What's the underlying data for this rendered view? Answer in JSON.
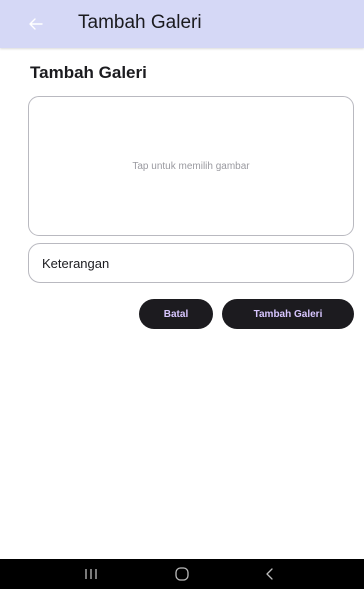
{
  "appbar": {
    "title": "Tambah Galeri",
    "back_icon": "arrow-left-icon",
    "background": "#d5d8f6"
  },
  "main": {
    "title": "Tambah Galeri",
    "image_picker": {
      "hint": "Tap untuk memilih gambar"
    },
    "caption_field": {
      "placeholder": "Keterangan",
      "value": ""
    },
    "buttons": {
      "cancel_label": "Batal",
      "submit_label": "Tambah Galeri",
      "background": "#1c1b1f",
      "text_color": "#d8c6ff"
    }
  },
  "system_nav": {
    "recents_icon": "recents-icon",
    "home_icon": "home-icon",
    "back_icon": "back-icon"
  }
}
